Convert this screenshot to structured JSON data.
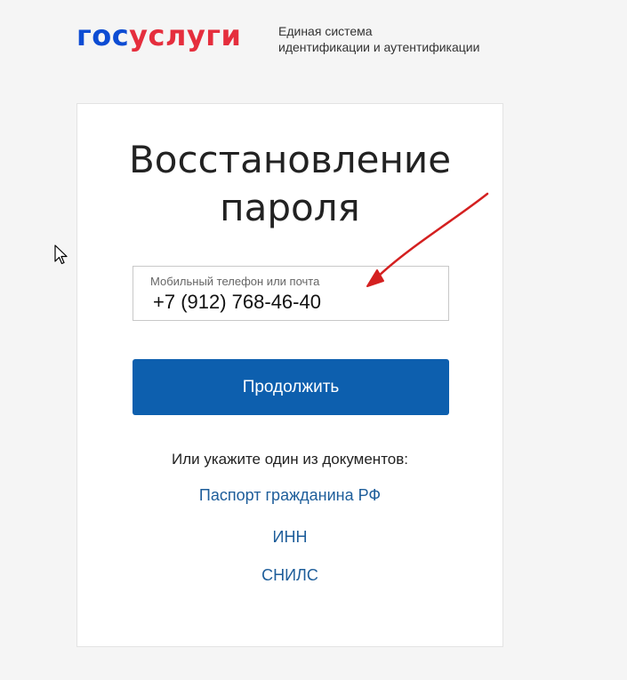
{
  "header": {
    "logo_gos": "гос",
    "logo_uslugi": "услуги",
    "tagline_line1": "Единая система",
    "tagline_line2": "идентификации и аутентификации"
  },
  "card": {
    "title_line1": "Восстановление",
    "title_line2": "пароля",
    "field": {
      "label": "Мобильный телефон или почта",
      "value": "+7 (912) 768-46-40"
    },
    "continue_label": "Продолжить",
    "docs_caption": "Или укажите один из документов:",
    "doc_links": [
      "Паспорт гражданина РФ",
      "ИНН",
      "СНИЛС"
    ]
  },
  "colors": {
    "brand_blue": "#0d4cd3",
    "brand_red": "#e52e3d",
    "button_blue": "#0d5fae",
    "link_blue": "#1d5d9a",
    "annotation_arrow": "#d42020"
  }
}
